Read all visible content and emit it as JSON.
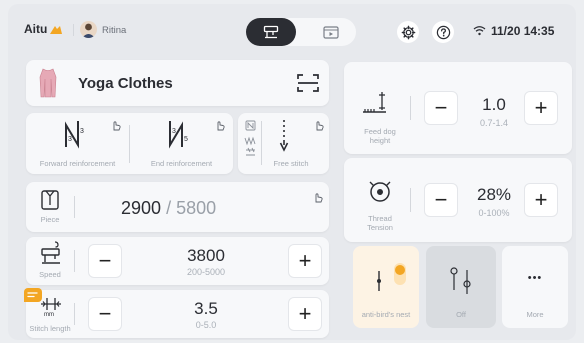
{
  "header": {
    "brand": "Aitu",
    "user": "Ritina",
    "datetime": "11/20 14:35"
  },
  "garment": {
    "title": "Yoga Clothes"
  },
  "reinforcement": {
    "forward_label": "Forward reinforcement",
    "end_label": "End reinforcement",
    "free_label": "Free stitch"
  },
  "piece": {
    "label": "Piece",
    "current": "2900",
    "separator": "/",
    "total": "5800"
  },
  "speed": {
    "label": "Speed",
    "value": "3800",
    "range": "200-5000",
    "minus": "−",
    "plus": "+"
  },
  "stitch": {
    "label": "Stitch length",
    "value": "3.5",
    "range": "0-5.0",
    "icon_text": "mm",
    "minus": "−",
    "plus": "+"
  },
  "feed_dog": {
    "label": "Feed dog height",
    "value": "1.0",
    "range": "0.7-1.4",
    "minus": "−",
    "plus": "+"
  },
  "thread": {
    "label": "Thread Tension",
    "value": "28%",
    "range": "0-100%",
    "minus": "−",
    "plus": "+"
  },
  "modes": {
    "anti_bird_label": "anti-bird's nest",
    "off_label": "Off",
    "more_label": "More",
    "more_glyph": "•••"
  },
  "colors": {
    "accent": "#f3a623",
    "dark_pill": "#2b2d33"
  }
}
